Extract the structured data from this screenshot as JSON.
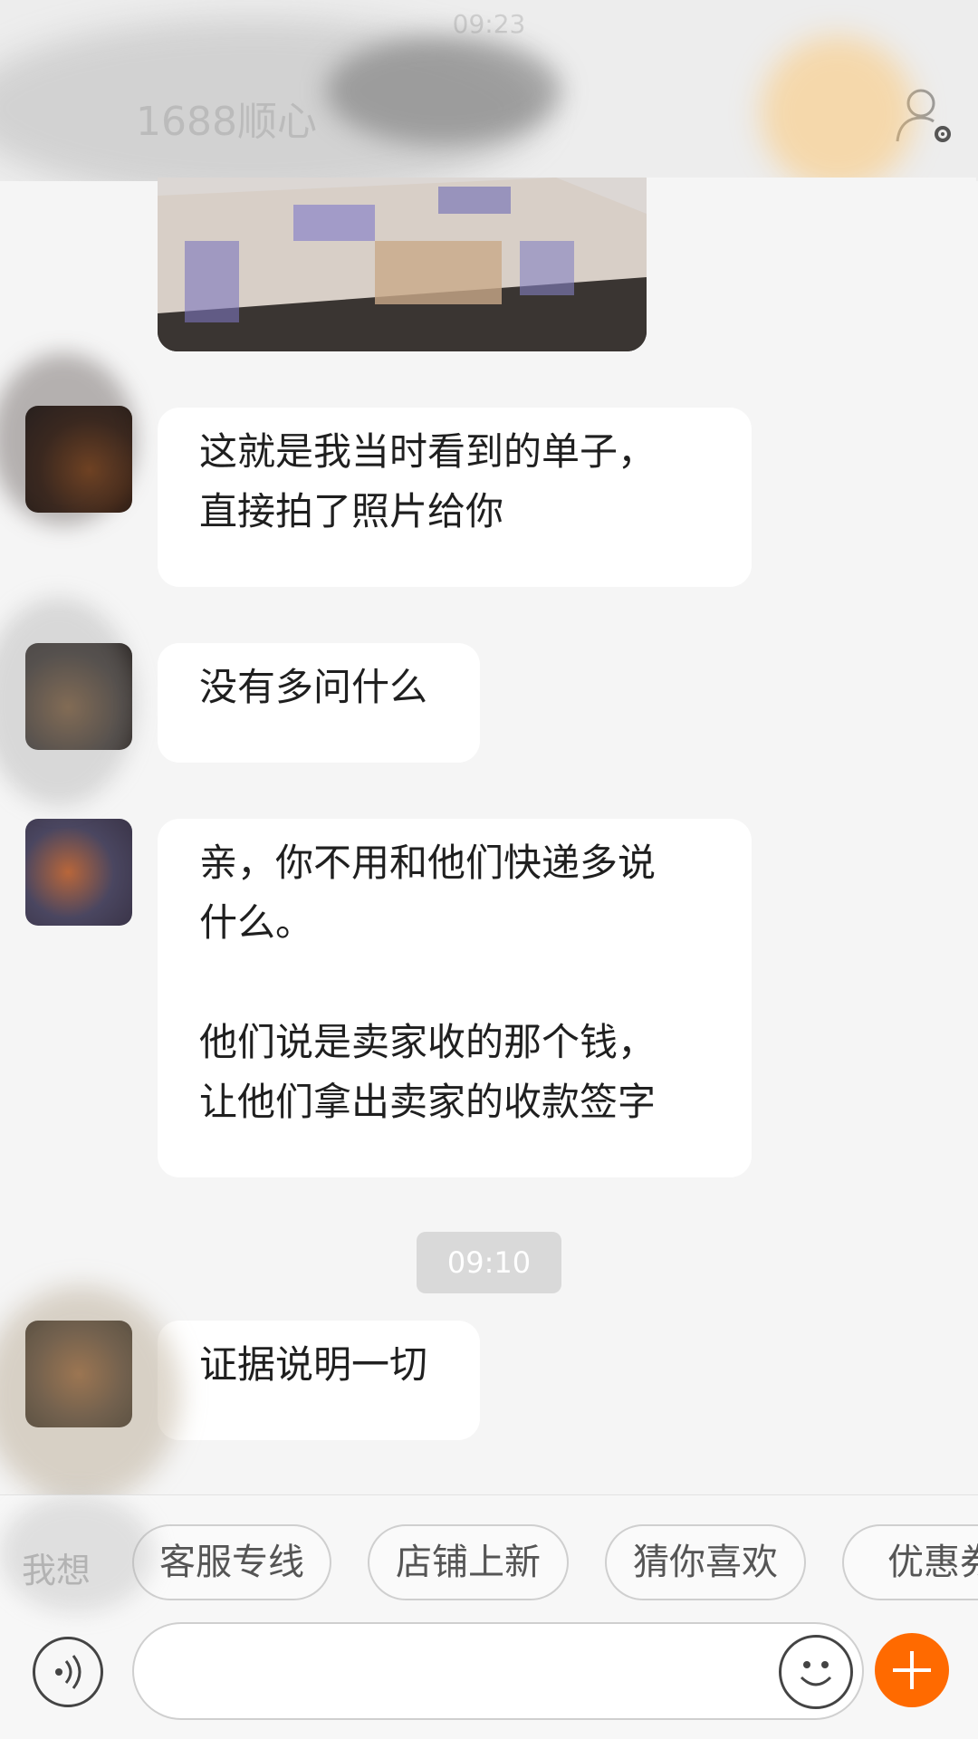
{
  "status_bar": {
    "time": "09:23"
  },
  "header": {
    "title": "1688顺心"
  },
  "messages": [
    {
      "text": "这就是我当时看到的单子，\n直接拍了照片给你"
    },
    {
      "text": "没有多问什么"
    },
    {
      "text": "亲，你不用和他们快递多说\n什么。\n\n他们说是卖家收的那个钱，\n让他们拿出卖家的收款签字"
    },
    {
      "text": "证据说明一切"
    }
  ],
  "time_divider": "09:10",
  "quick_bar": {
    "label": "我想",
    "chips": [
      "客服专线",
      "店铺上新",
      "猜你喜欢",
      "优惠券"
    ]
  },
  "input": {
    "placeholder": ""
  },
  "icons": {
    "profile": "profile-settings-icon",
    "voice": "voice-icon",
    "emoji": "emoji-icon",
    "plus": "plus-icon"
  },
  "colors": {
    "accent": "#ff6a00",
    "chat_bg": "#f5f5f5",
    "bubble": "#ffffff",
    "timestamp_bg": "#d9d9d9"
  }
}
